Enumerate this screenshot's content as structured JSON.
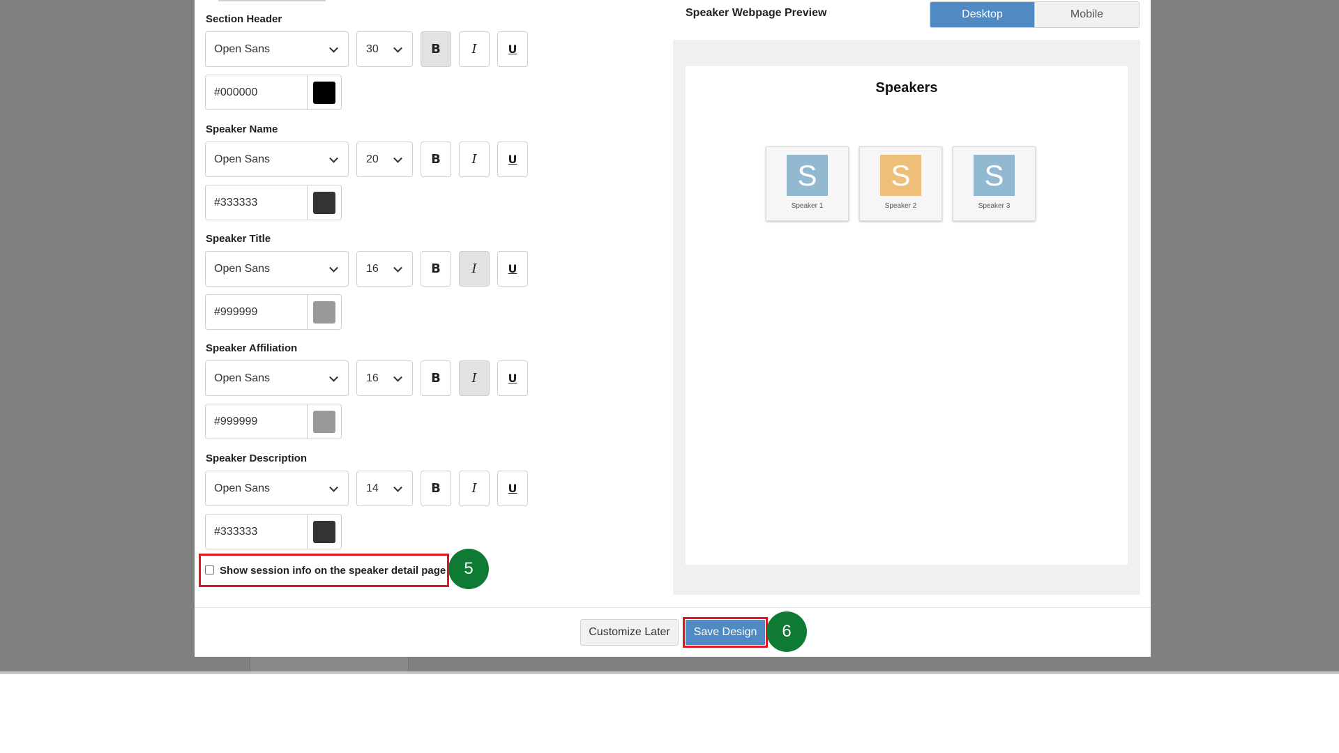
{
  "settings": {
    "sections": [
      {
        "label": "Section Header",
        "font": "Open Sans",
        "size": "30",
        "bold": true,
        "italic": false,
        "color_value": "#000000",
        "swatch": "#000000"
      },
      {
        "label": "Speaker Name",
        "font": "Open Sans",
        "size": "20",
        "bold": false,
        "italic": false,
        "color_value": "#333333",
        "swatch": "#333333"
      },
      {
        "label": "Speaker Title",
        "font": "Open Sans",
        "size": "16",
        "bold": false,
        "italic": true,
        "color_value": "#999999",
        "swatch": "#999999"
      },
      {
        "label": "Speaker Affiliation",
        "font": "Open Sans",
        "size": "16",
        "bold": false,
        "italic": true,
        "color_value": "#999999",
        "swatch": "#999999"
      },
      {
        "label": "Speaker Description",
        "font": "Open Sans",
        "size": "14",
        "bold": false,
        "italic": false,
        "color_value": "#333333",
        "swatch": "#333333"
      }
    ],
    "format_buttons": {
      "bold": "B",
      "italic": "I",
      "underline": "U"
    },
    "session_checkbox_label": "Show session info on the speaker detail page",
    "session_checkbox_checked": false
  },
  "steps": {
    "checkbox_step": "5",
    "save_step": "6"
  },
  "preview": {
    "title": "Speaker Webpage Preview",
    "toggle": {
      "desktop": "Desktop",
      "mobile": "Mobile",
      "active": "Desktop"
    },
    "heading": "Speakers",
    "speakers": [
      {
        "initial": "S",
        "name": "Speaker 1",
        "color": "#93b9d1"
      },
      {
        "initial": "S",
        "name": "Speaker 2",
        "color": "#edbf79"
      },
      {
        "initial": "S",
        "name": "Speaker 3",
        "color": "#93b9d1"
      }
    ]
  },
  "footer": {
    "customize_later": "Customize Later",
    "save_design": "Save Design"
  },
  "colors": {
    "accent": "#4f8ac4",
    "step_badge": "#0e7a33",
    "highlight": "#e0161f"
  }
}
